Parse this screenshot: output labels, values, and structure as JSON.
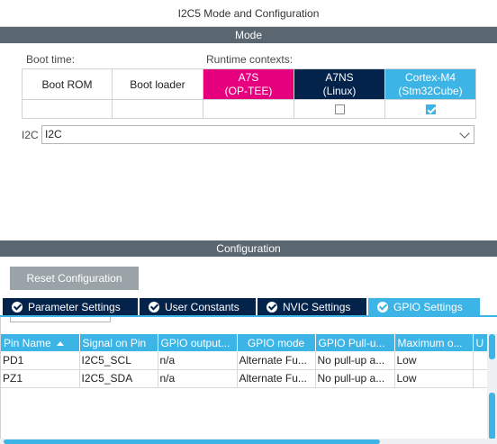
{
  "window": {
    "title": "I2C5 Mode and Configuration"
  },
  "mode": {
    "section_label": "Mode",
    "boot_time_label": "Boot time:",
    "runtime_contexts_label": "Runtime contexts:",
    "contexts": [
      {
        "line1": "Boot ROM",
        "line2": "",
        "checked": null
      },
      {
        "line1": "Boot loader",
        "line2": "",
        "checked": null
      },
      {
        "line1": "A7S",
        "line2": "(OP-TEE)",
        "checked": null,
        "color": "#e6007e"
      },
      {
        "line1": "A7NS",
        "line2": "(Linux)",
        "checked": false,
        "color": "#03234b"
      },
      {
        "line1": "Cortex-M4",
        "line2": "(Stm32Cube)",
        "checked": true,
        "color": "#3cb4e6"
      }
    ],
    "i2c_field": {
      "label": "I2C",
      "value": "I2C"
    }
  },
  "configuration": {
    "section_label": "Configuration",
    "reset_button": "Reset Configuration",
    "tabs": [
      {
        "label": "Parameter Settings",
        "active": false
      },
      {
        "label": "User Constants",
        "active": false
      },
      {
        "label": "NVIC Settings",
        "active": false
      },
      {
        "label": "GPIO Settings",
        "active": true
      }
    ],
    "table": {
      "columns": [
        "Pin Name",
        "Signal on Pin",
        "GPIO output...",
        "GPIO mode",
        "GPIO Pull-u...",
        "Maximum o...",
        "U"
      ],
      "rows": [
        [
          "PD1",
          "I2C5_SCL",
          "n/a",
          "Alternate Fu...",
          "No pull-up a...",
          "Low",
          ""
        ],
        [
          "PZ1",
          "I2C5_SDA",
          "n/a",
          "Alternate Fu...",
          "No pull-up a...",
          "Low",
          ""
        ]
      ]
    }
  },
  "colors": {
    "accent": "#3cb4e6",
    "navy": "#03234b",
    "magenta": "#e6007e",
    "section_bar": "#5b6770"
  }
}
